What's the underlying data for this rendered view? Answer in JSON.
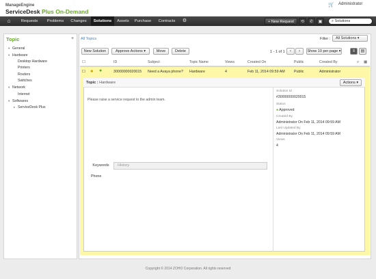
{
  "header": {
    "logo_top": "ManageEngine",
    "logo_main": "ServiceDesk",
    "logo_accent": "Plus On-Demand",
    "user": "Administrator"
  },
  "nav": {
    "items": [
      "Requests",
      "Problems",
      "Changes",
      "Solutions",
      "Assets",
      "Purchase",
      "Contracts"
    ],
    "active": "Solutions",
    "new_request": "+ New Request",
    "search_placeholder": "Solutions"
  },
  "sidebar": {
    "title": "Topic",
    "add": "+",
    "tree": [
      "General",
      "Hardware",
      "Desktop Hardware",
      "Printers",
      "Routers",
      "Switches",
      "Network",
      "Internet",
      "Softwares",
      "ServiceDesk Plus"
    ]
  },
  "toolbar": {
    "breadcrumb": "All Topics",
    "filter_label": "Filter :",
    "filter_value": "All Solutions",
    "new_solution": "New Solution",
    "approve_actions": "Approve Actions",
    "move": "Move",
    "delete": "Delete",
    "pager": "1 - 1 of 1",
    "per_page": "Show 10 per page"
  },
  "table": {
    "columns": [
      "ID",
      "Subject",
      "Topic Name",
      "Views",
      "Created On",
      "Public",
      "Created By"
    ],
    "row": {
      "id": "30000000020015",
      "subject": "Need a Avaya phone?",
      "topic": "Hardware",
      "views": "4",
      "created_on": "Feb 11, 2014 09:59 AM",
      "public": "Public",
      "created_by": "Administrator"
    }
  },
  "detail": {
    "topic_label": "Topic :",
    "topic_value": "Hardware",
    "actions": "Actions",
    "body": "Please raise a service request to the admin team.",
    "solution_id_label": "Solution Id",
    "solution_id": "#30000000020015",
    "status_label": "Status",
    "status": "Approved",
    "created_by_label": "Created By",
    "created_by": "Administrator On Feb 11, 2014 09:59 AM",
    "updated_by_label": "Last Updated By",
    "updated_by": "Administrator On Feb 11, 2014 09:59 AM",
    "views_label": "Views",
    "views": "4",
    "tab_keywords": "Keywords",
    "tab_history": "History",
    "keywords": "Phone"
  },
  "footer": "Copyright © 2014 ZOHO Corporation. All rights reserved",
  "colors": {
    "accent": "#6aa82b",
    "highlight": "#fdf8a8",
    "link": "#3f7fbf"
  }
}
